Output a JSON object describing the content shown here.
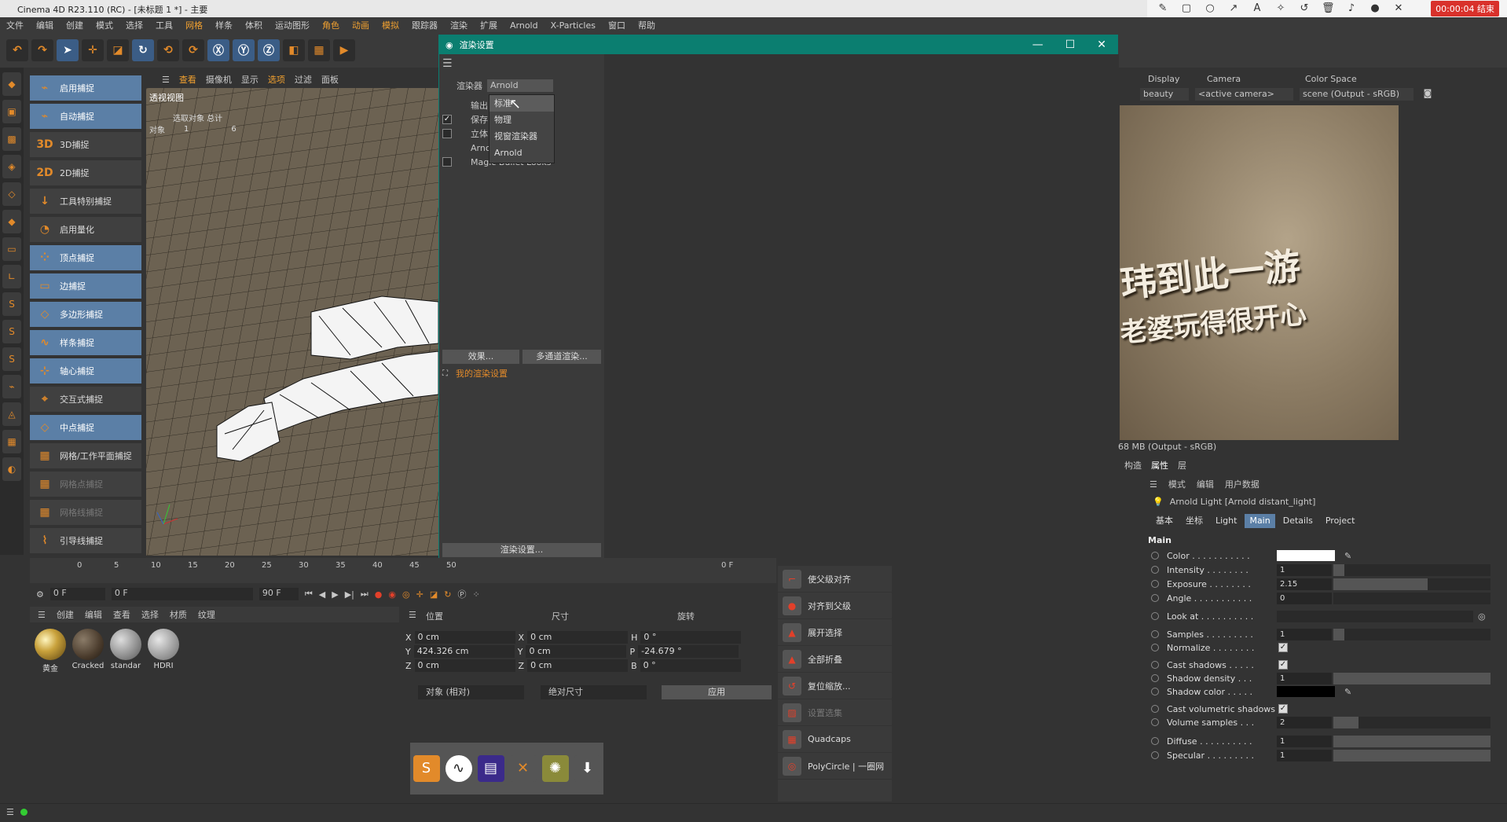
{
  "window": {
    "title": "Cinema 4D R23.110 (RC) - [未标题 1 *] - 主要"
  },
  "recorder": {
    "timer": "00:00:04 结束"
  },
  "menu": [
    "文件",
    "编辑",
    "创建",
    "模式",
    "选择",
    "工具",
    "网格",
    "样条",
    "体积",
    "运动图形",
    "角色",
    "动画",
    "模拟",
    "跟踪器",
    "渲染",
    "扩展",
    "Arnold",
    "X-Particles",
    "窗口",
    "帮助"
  ],
  "snap": {
    "items": [
      "启用捕捉",
      "自动捕捉",
      "3D捕捉",
      "2D捕捉",
      "工具特别捕捉",
      "启用量化",
      "顶点捕捉",
      "边捕捉",
      "多边形捕捉",
      "样条捕捉",
      "轴心捕捉",
      "交互式捕捉",
      "中点捕捉",
      "网格/工作平面捕捉",
      "网格点捕捉",
      "网格线捕捉",
      "引导线捕捉"
    ]
  },
  "viewport": {
    "menu": [
      "查看",
      "摄像机",
      "显示",
      "选项",
      "过滤",
      "面板"
    ],
    "label": "透视视图",
    "stats_header": "选取对象  总计",
    "stats_label": "对象",
    "stats_sel": "1",
    "stats_total": "6"
  },
  "render_settings": {
    "title": "渲染设置",
    "renderer_label": "渲染器",
    "renderer_value": "Arnold",
    "items": [
      "输出",
      "保存",
      "立体",
      "Arnold",
      "Magic Bullet Looks"
    ],
    "dropdown": [
      "标准",
      "物理",
      "视窗渲染器",
      "Arnold"
    ],
    "effects_btn": "效果...",
    "multipass_btn": "多通道渲染...",
    "my_settings": "我的渲染设置",
    "bottom_btn": "渲染设置..."
  },
  "ipr": {
    "display_label": "Display",
    "display_value": "beauty",
    "camera_label": "Camera",
    "camera_value": "<active camera>",
    "colorspace_label": "Color Space",
    "colorspace_value": "scene (Output - sRGB)",
    "status": "68 MB (Output - sRGB)",
    "image_line1": "玮到此一游",
    "image_line2": "老婆玩得很开心"
  },
  "attributes": {
    "top_tabs": [
      "构造",
      "属性",
      "层"
    ],
    "menu": [
      "模式",
      "编辑",
      "用户数据"
    ],
    "object": "Arnold Light [Arnold distant_light]",
    "tabs": [
      "基本",
      "坐标",
      "Light",
      "Main",
      "Details",
      "Project"
    ],
    "section": "Main",
    "rows": [
      {
        "label": "Color . . . . . . . . . . .",
        "value": ""
      },
      {
        "label": "Intensity . . . . . . . .",
        "value": "1"
      },
      {
        "label": "Exposure . . . . . . . .",
        "value": "2.15"
      },
      {
        "label": "Angle . . . . . . . . . . .",
        "value": "0"
      },
      {
        "label": "Look at . . . . . . . . . .",
        "value": ""
      },
      {
        "label": "Samples . . . . . . . . .",
        "value": "1"
      },
      {
        "label": "Normalize . . . . . . . .",
        "value": ""
      },
      {
        "label": "Cast shadows . . . . .",
        "value": ""
      },
      {
        "label": "Shadow density . . .",
        "value": "1"
      },
      {
        "label": "Shadow color . . . . .",
        "value": ""
      },
      {
        "label": "Cast volumetric shadows",
        "value": ""
      },
      {
        "label": "Volume samples . . .",
        "value": "2"
      },
      {
        "label": "Diffuse . . . . . . . . . .",
        "value": "1"
      },
      {
        "label": "Specular . . . . . . . . .",
        "value": "1"
      }
    ],
    "fills": {
      "intensity": 0.07,
      "exposure": 0.6,
      "samples": 0.07,
      "shadow_density": 1.0,
      "volume_samples": 0.16,
      "diffuse": 1.0,
      "specular": 1.0
    }
  },
  "timeline": {
    "ticks": [
      "0",
      "5",
      "10",
      "15",
      "20",
      "25",
      "30",
      "35",
      "40",
      "45",
      "50"
    ],
    "end_tick": "0 F",
    "start": "0 F",
    "current": "0 F",
    "range_end": "90 F",
    "max": "90 F"
  },
  "materials": {
    "menu": [
      "创建",
      "编辑",
      "查看",
      "选择",
      "材质",
      "纹理"
    ],
    "items": [
      "黄金",
      "Cracked",
      "standar",
      "HDRI"
    ]
  },
  "coords": {
    "headers": [
      "位置",
      "尺寸",
      "旋转"
    ],
    "rows": [
      {
        "a": "X",
        "pos": "0 cm",
        "b": "X",
        "size": "0 cm",
        "c": "H",
        "rot": "0 °"
      },
      {
        "a": "Y",
        "pos": "424.326 cm",
        "b": "Y",
        "size": "0 cm",
        "c": "P",
        "rot": "-24.679 °"
      },
      {
        "a": "Z",
        "pos": "0 cm",
        "b": "Z",
        "size": "0 cm",
        "c": "B",
        "rot": "0 °"
      }
    ],
    "mode1": "对象 (相对)",
    "mode2": "绝对尺寸",
    "apply": "应用"
  },
  "align": {
    "items": [
      "使父级对齐",
      "对齐到父级",
      "展开选择",
      "全部折叠",
      "复位缩放...",
      "设置选集",
      "Quadcaps",
      "PolyCircle | 一圈网"
    ]
  }
}
